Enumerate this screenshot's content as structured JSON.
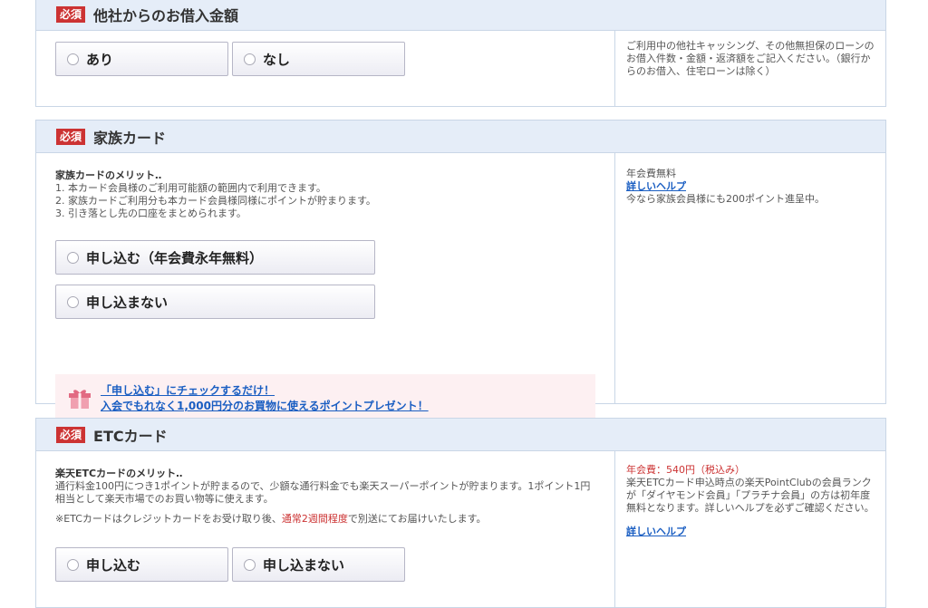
{
  "required_badge": "必須",
  "other_loans": {
    "title": "他社からのお借入金額",
    "options": [
      "あり",
      "なし"
    ],
    "note": "ご利用中の他社キャッシング、その他無担保のローンのお借入件数・金額・返済額をご記入ください。（銀行からのお借入、住宅ローンは除く）"
  },
  "family_card": {
    "title": "家族カード",
    "merit_title": "家族カードのメリット‥",
    "merits": [
      "1. 本カード会員様のご利用可能額の範囲内で利用できます。",
      "2. 家族カードご利用分も本カード会員様同様にポイントが貯まります。",
      "3. 引き落とし先の口座をまとめられます。"
    ],
    "options": [
      "申し込む（年会費永年無料）",
      "申し込まない"
    ],
    "promo_line1": "「申し込む」にチェックするだけ！",
    "promo_line2": "入会でもれなく1,000円分のお買物に使えるポイントプレゼント！",
    "side_fee": "年会費無料",
    "side_help": "詳しいヘルプ",
    "side_note": "今なら家族会員様にも200ポイント進呈中。"
  },
  "etc_card": {
    "title": "ETCカード",
    "merit_title": "楽天ETCカードのメリット‥",
    "merit_text": "通行料金100円につき1ポイントが貯まるので、少額な通行料金でも楽天スーパーポイントが貯まります。1ポイント1円相当として楽天市場でのお買い物等に使えます。",
    "notice_pre": "※ETCカードはクレジットカードをお受け取り後、",
    "notice_red": "通常2週間程度",
    "notice_post": "で別送にてお届けいたします。",
    "options": [
      "申し込む",
      "申し込まない"
    ],
    "side_fee": "年会費：540円（税込み）",
    "side_note": "楽天ETCカード申込時点の楽天PointClubの会員ランクが「ダイヤモンド会員」「プラチナ会員」の方は初年度無料となります。詳しいヘルプを必ずご確認ください。",
    "side_help": "詳しいヘルプ"
  },
  "colors": {
    "required_badge": "#cc3333",
    "header_bg": "#e5edf8",
    "link": "#1a5ec2",
    "promo_bg": "#fdf0f2"
  }
}
